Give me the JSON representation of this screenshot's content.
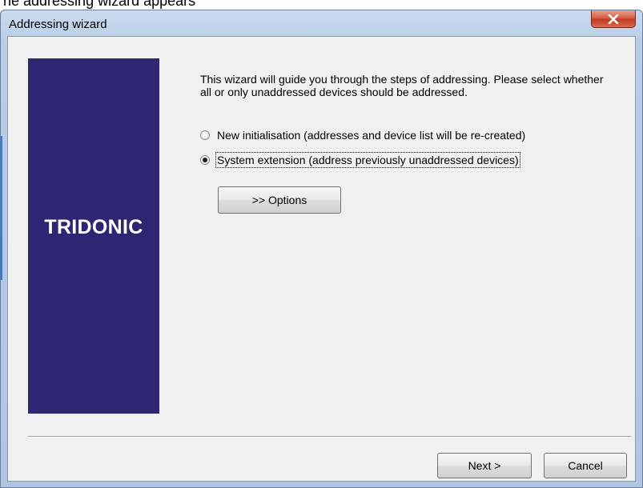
{
  "window": {
    "title": "Addressing wizard",
    "close_icon": "close-icon"
  },
  "background_caption": "ne addressing wizard appears",
  "brand": {
    "name": "TRIDONIC",
    "panel_color": "#2c2673"
  },
  "intro_text": "This wizard will guide you through the steps of addressing. Please select whether all or only unaddressed devices should be addressed.",
  "options": [
    {
      "label": "New initialisation (addresses and device list will be re-created)",
      "selected": false
    },
    {
      "label": "System extension (address previously unaddressed devices)",
      "selected": true
    }
  ],
  "buttons": {
    "options_label": ">> Options",
    "next_label": "Next >",
    "cancel_label": "Cancel"
  }
}
